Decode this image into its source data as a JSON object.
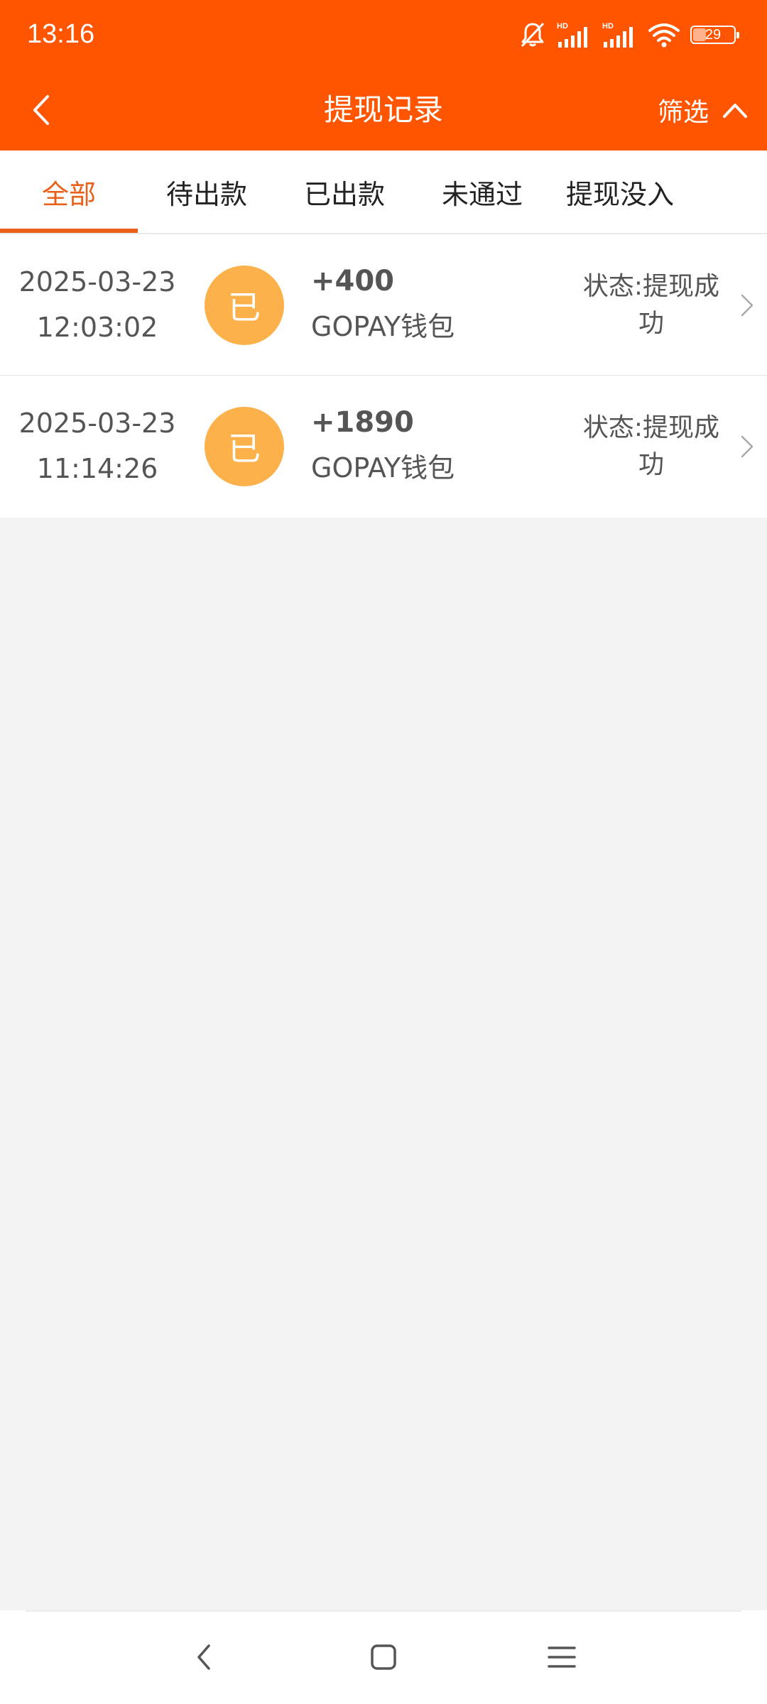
{
  "status_bar": {
    "time": "13:16",
    "battery_level": "29",
    "icons": [
      "bell-muted-icon",
      "hd-signal-icon",
      "hd-signal-icon",
      "wifi-icon",
      "battery-icon"
    ]
  },
  "header": {
    "title": "提现记录",
    "filter_label": "筛选",
    "back_icon": "chevron-left-icon",
    "filter_icon": "chevron-up-icon"
  },
  "tabs": [
    {
      "label": "全部",
      "active": true
    },
    {
      "label": "待出款",
      "active": false
    },
    {
      "label": "已出款",
      "active": false
    },
    {
      "label": "未通过",
      "active": false
    },
    {
      "label": "提现没入",
      "active": false
    }
  ],
  "records": [
    {
      "date": "2025-03-23",
      "time": "12:03:02",
      "badge": "已",
      "amount": "+400",
      "method": "GOPAY钱包",
      "status_line1": "状态:提现成",
      "status_line2": "功"
    },
    {
      "date": "2025-03-23",
      "time": "11:14:26",
      "badge": "已",
      "amount": "+1890",
      "method": "GOPAY钱包",
      "status_line1": "状态:提现成",
      "status_line2": "功"
    }
  ],
  "colors": {
    "brand": "#ff5500",
    "tab_active": "#e8601a",
    "badge": "#fcb14b",
    "background": "#f3f3f3"
  }
}
